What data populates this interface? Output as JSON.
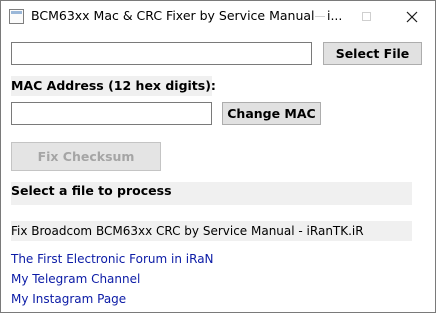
{
  "window": {
    "title": "BCM63xx Mac & CRC Fixer by Service Manual - i...",
    "icon": "app-window-icon"
  },
  "file": {
    "value": "",
    "select_label": "Select File"
  },
  "mac": {
    "label": "MAC Address (12 hex digits):",
    "value": "",
    "change_label": "Change MAC"
  },
  "fix": {
    "label": "Fix Checksum",
    "enabled": false
  },
  "status": {
    "text": "Select a file to process"
  },
  "footer": {
    "text": "Fix Broadcom BCM63xx CRC by Service Manual - iRanTK.iR"
  },
  "links": [
    {
      "label": "The First Electronic Forum in iRaN"
    },
    {
      "label": "My Telegram Channel"
    },
    {
      "label": "My Instagram Page"
    }
  ],
  "colors": {
    "link": "#0b1ba6",
    "disabled_text": "#a5a5a5",
    "panel_bg": "#f0f0f0"
  }
}
